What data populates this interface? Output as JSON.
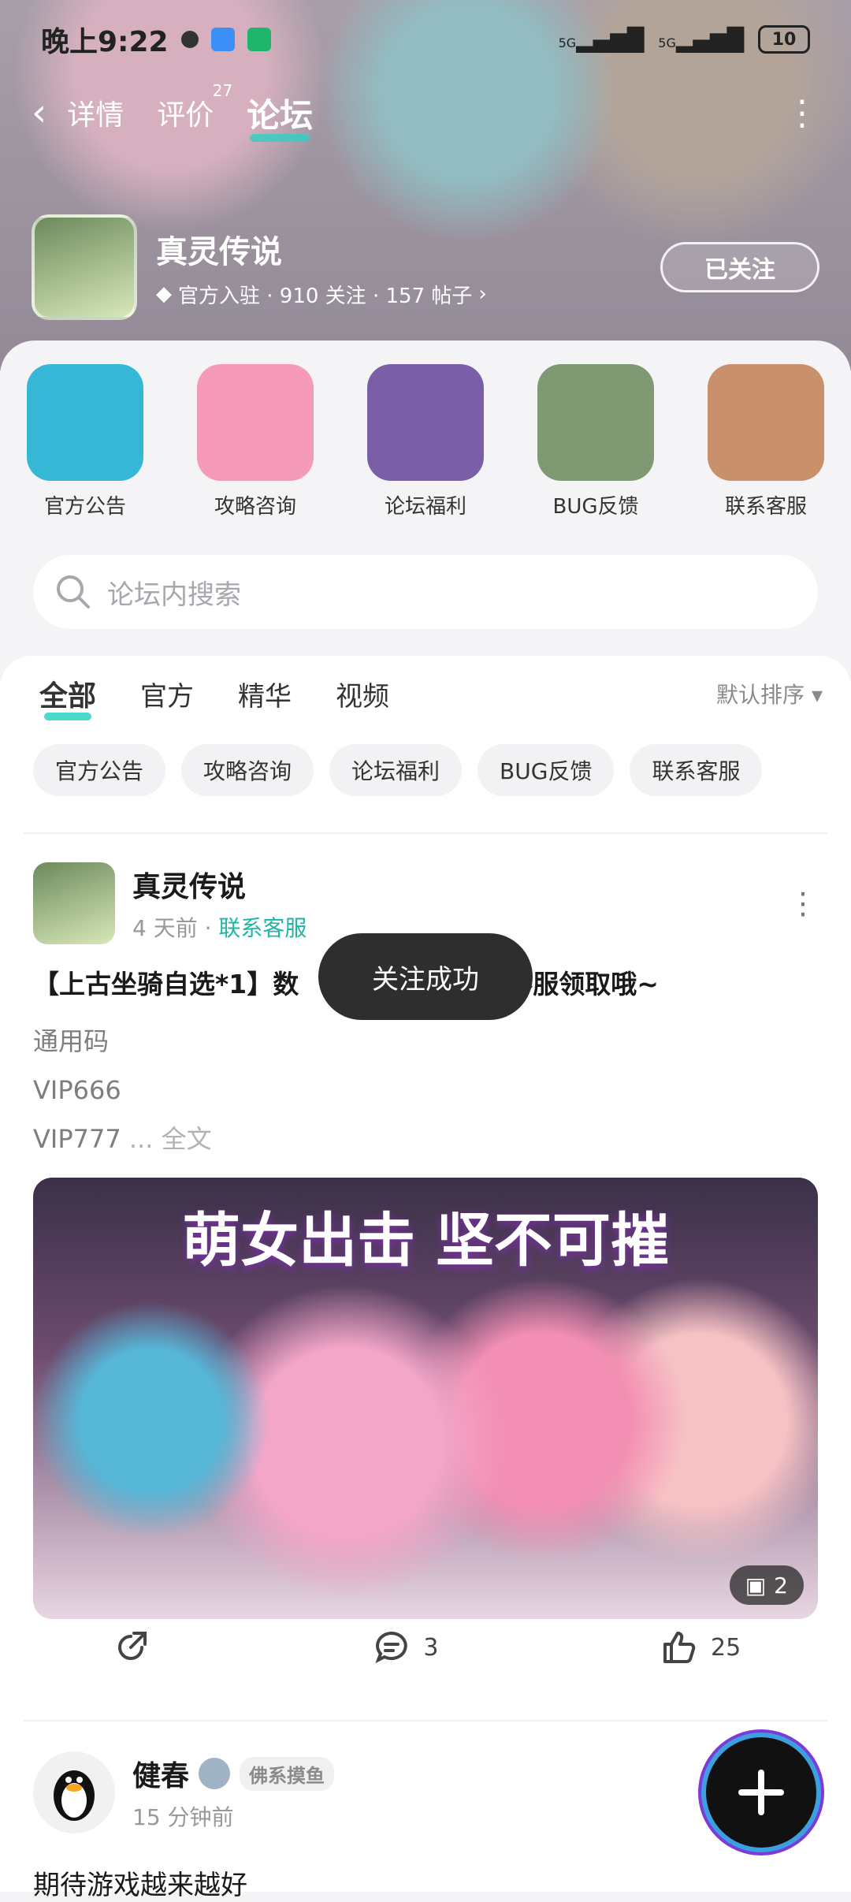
{
  "status_bar": {
    "time": "晚上9:22",
    "signal_1": "5G",
    "signal_2": "5G",
    "battery": "10"
  },
  "nav": {
    "tabs": [
      "详情",
      "评价",
      "论坛"
    ],
    "review_count": "27",
    "active_tab": "论坛"
  },
  "game": {
    "name": "真灵传说",
    "stats": "官方入驻 · 910 关注 · 157 帖子",
    "follow_label": "已关注"
  },
  "categories": [
    {
      "label": "官方公告",
      "color": "#35b7d5"
    },
    {
      "label": "攻略咨询",
      "color": "#f59ab8"
    },
    {
      "label": "论坛福利",
      "color": "#7a5fa8"
    },
    {
      "label": "BUG反馈",
      "color": "#7f9a72"
    },
    {
      "label": "联系客服",
      "color": "#c9906c"
    }
  ],
  "search": {
    "placeholder": "论坛内搜索"
  },
  "feed_tabs": [
    "全部",
    "官方",
    "精华",
    "视频"
  ],
  "sort_label": "默认排序",
  "chips": [
    "官方公告",
    "攻略咨询",
    "论坛福利",
    "BUG反馈",
    "联系客服"
  ],
  "post1": {
    "author": "真灵传说",
    "time": "4 天前",
    "tag": "联系客服",
    "title": "【上古坐骑自选*1】数",
    "title_tail": "客服领取哦~",
    "lines": [
      "通用码",
      "VIP666",
      "VIP777"
    ],
    "more": "... 全文",
    "image_banner": "萌女出击 坚不可摧",
    "image_count": "2",
    "comments": "3",
    "likes": "25"
  },
  "post2": {
    "author": "健春",
    "badge": "佛系摸鱼",
    "time": "15 分钟前",
    "text": "期待游戏越来越好"
  },
  "toast": "关注成功",
  "colors": {
    "accent": "#2fd0c2",
    "tag": "#1eb7a5"
  }
}
